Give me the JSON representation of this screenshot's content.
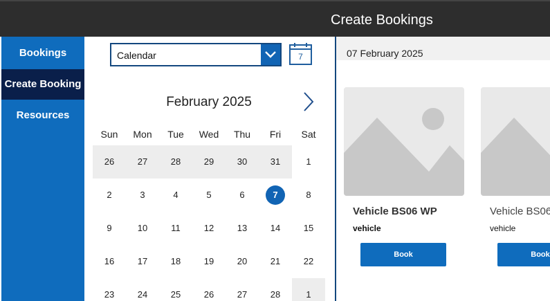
{
  "header": {
    "title": "Create Bookings"
  },
  "sidebar": {
    "items": [
      {
        "label": "Bookings",
        "active": false
      },
      {
        "label": "Create Booking",
        "active": true
      },
      {
        "label": "Resources",
        "active": false
      }
    ]
  },
  "view_selector": {
    "value": "Calendar"
  },
  "calendar_icon": {
    "label": "7"
  },
  "calendar": {
    "month_label": "February 2025",
    "weekdays": [
      "Sun",
      "Mon",
      "Tue",
      "Wed",
      "Thu",
      "Fri",
      "Sat"
    ],
    "weeks": [
      [
        "26",
        "27",
        "28",
        "29",
        "30",
        "31",
        "1"
      ],
      [
        "2",
        "3",
        "4",
        "5",
        "6",
        "7",
        "8"
      ],
      [
        "9",
        "10",
        "11",
        "12",
        "13",
        "14",
        "15"
      ],
      [
        "16",
        "17",
        "18",
        "19",
        "20",
        "21",
        "22"
      ],
      [
        "23",
        "24",
        "25",
        "26",
        "27",
        "28",
        "1"
      ]
    ],
    "selected_day": "7"
  },
  "selected_date": "07 February 2025",
  "resources": [
    {
      "name": "Vehicle BS06 WP",
      "type": "vehicle",
      "button_label": "Book"
    },
    {
      "name": "Vehicle BS06",
      "type": "vehicle",
      "button_label": "Book"
    }
  ],
  "colors": {
    "accent": "#0f6cbd",
    "header_bg": "#2d2d2d",
    "nav_active_bg": "#0a1f4a",
    "outside_day_bg": "#ededed",
    "image_placeholder_bg": "#e9e9e9"
  }
}
